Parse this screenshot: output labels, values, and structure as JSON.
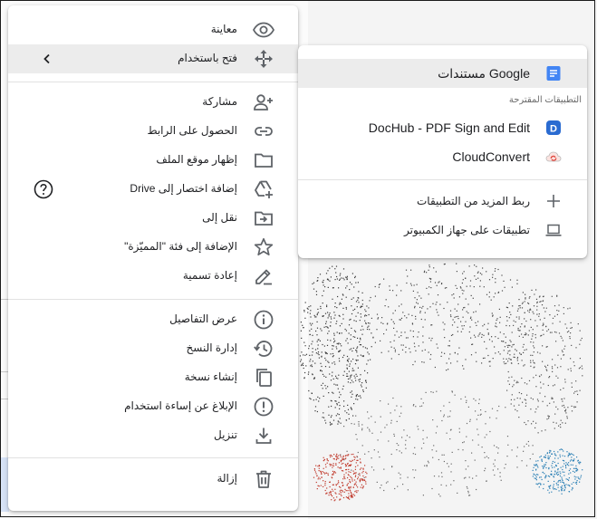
{
  "menu": {
    "items": [
      {
        "label": "معاينة",
        "icon": "eye-icon"
      },
      {
        "label": "فتح باستخدام",
        "icon": "move-icon"
      },
      {
        "label": "مشاركة",
        "icon": "person-add-icon"
      },
      {
        "label": "الحصول على الرابط",
        "icon": "link-icon"
      },
      {
        "label": "إظهار موقع الملف",
        "icon": "folder-icon"
      },
      {
        "label": "إضافة اختصار إلى Drive",
        "icon": "drive-shortcut-icon"
      },
      {
        "label": "نقل إلى",
        "icon": "move-to-folder-icon"
      },
      {
        "label": "الإضافة إلى فئة \"المميّزة\"",
        "icon": "star-icon"
      },
      {
        "label": "إعادة تسمية",
        "icon": "pencil-icon"
      },
      {
        "label": "عرض التفاصيل",
        "icon": "info-icon"
      },
      {
        "label": "إدارة النسخ",
        "icon": "history-icon"
      },
      {
        "label": "إنشاء نسخة",
        "icon": "copy-icon"
      },
      {
        "label": "الإبلاغ عن إساءة استخدام",
        "icon": "report-icon"
      },
      {
        "label": "تنزيل",
        "icon": "download-icon"
      },
      {
        "label": "إزالة",
        "icon": "trash-icon"
      }
    ]
  },
  "submenu": {
    "google_docs": "مستندات Google",
    "suggested_heading": "التطبيقات المقترحة",
    "dochub": "DocHub - PDF Sign and Edit",
    "cloudconvert": "CloudConvert",
    "connect_more": "ربط المزيد من التطبيقات",
    "computer_apps": "تطبيقات على جهاز الكمبيوتر"
  },
  "colors": {
    "docs_blue": "#4285f4",
    "dochub_blue": "#2a6bd1",
    "cloudconvert_red": "#e04b42",
    "icon_gray": "#5f6368"
  }
}
